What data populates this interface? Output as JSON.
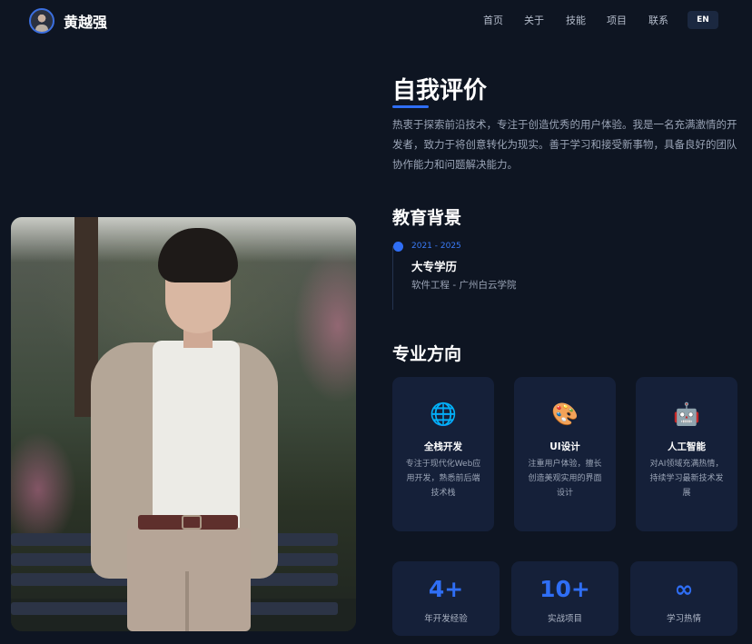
{
  "nav": {
    "brand_name": "黄越强",
    "links": [
      "首页",
      "关于",
      "技能",
      "项目",
      "联系"
    ],
    "lang_button": "EN"
  },
  "about": {
    "title": "自我评价",
    "text": "热衷于探索前沿技术，专注于创造优秀的用户体验。我是一名充满激情的开发者，致力于将创意转化为现实。善于学习和接受新事物，具备良好的团队协作能力和问题解决能力。"
  },
  "education": {
    "title": "教育背景",
    "items": [
      {
        "date": "2021 - 2025",
        "degree": "大专学历",
        "school": "软件工程 - 广州白云学院"
      }
    ]
  },
  "specialties": {
    "title": "专业方向",
    "cards": [
      {
        "icon": "globe-icon",
        "glyph": "🌐",
        "title": "全栈开发",
        "desc": "专注于现代化Web应用开发，熟悉前后端技术栈"
      },
      {
        "icon": "palette-icon",
        "glyph": "🎨",
        "title": "UI设计",
        "desc": "注重用户体验，擅长创造美观实用的界面设计"
      },
      {
        "icon": "robot-icon",
        "glyph": "🤖",
        "title": "人工智能",
        "desc": "对AI领域充满热情，持续学习最新技术发展"
      }
    ]
  },
  "stats": [
    {
      "value": "4+",
      "label": "年开发经验"
    },
    {
      "value": "10+",
      "label": "实战项目"
    },
    {
      "value": "∞",
      "label": "学习热情"
    }
  ],
  "colors": {
    "background": "#0e1522",
    "card": "#152039",
    "accent": "#2f6ef5"
  }
}
